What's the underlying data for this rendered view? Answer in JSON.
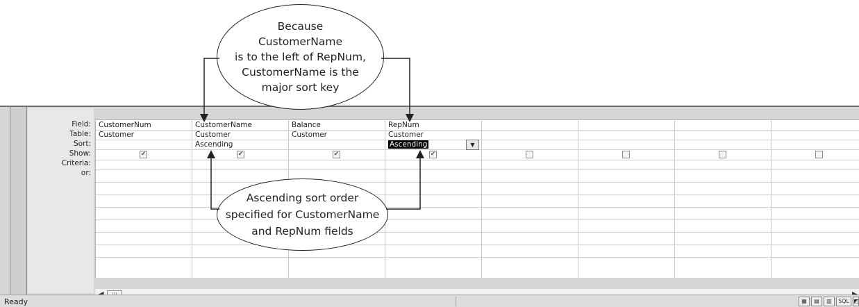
{
  "callouts": {
    "top": "Because\nCustomerName\nis to the left of RepNum,\nCustomerName is the\nmajor sort key",
    "middle": "Ascending sort order\nspecified for CustomerName\nand RepNum fields"
  },
  "row_labels": [
    "Field:",
    "Table:",
    "Sort:",
    "Show:",
    "Criteria:",
    "or:"
  ],
  "columns": [
    {
      "field": "CustomerNum",
      "table": "Customer",
      "sort": "",
      "show": true
    },
    {
      "field": "CustomerName",
      "table": "Customer",
      "sort": "Ascending",
      "show": true
    },
    {
      "field": "Balance",
      "table": "Customer",
      "sort": "",
      "show": true
    },
    {
      "field": "RepNum",
      "table": "Customer",
      "sort": "Ascending",
      "show": true,
      "selected": true
    },
    {
      "field": "",
      "table": "",
      "sort": "",
      "show": false
    },
    {
      "field": "",
      "table": "",
      "sort": "",
      "show": false
    },
    {
      "field": "",
      "table": "",
      "sort": "",
      "show": false
    },
    {
      "field": "",
      "table": "",
      "sort": "",
      "show": false
    }
  ],
  "icons": {
    "dropdown": "chevron-down-icon",
    "checked": "checkmark-icon",
    "scroll_left": "arrow-left-icon",
    "scroll_right": "arrow-right-icon"
  },
  "scrollbar": {
    "thumb_grip": "|||"
  },
  "status": {
    "text": "Ready",
    "views": [
      "",
      "",
      "",
      "SQL"
    ]
  }
}
